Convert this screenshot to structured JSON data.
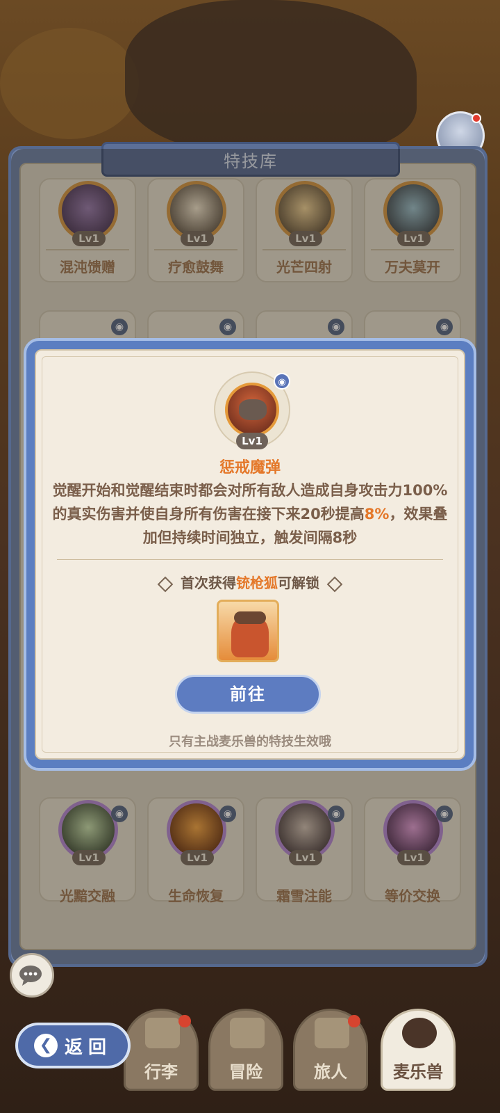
{
  "library": {
    "title": "特技库",
    "row1": [
      {
        "name": "混沌馈赠",
        "level": "Lv1"
      },
      {
        "name": "疗愈鼓舞",
        "level": "Lv1"
      },
      {
        "name": "光芒四射",
        "level": "Lv1"
      },
      {
        "name": "万夫莫开",
        "level": "Lv1"
      }
    ],
    "row3": [
      {
        "name": "光黯交融",
        "level": "Lv1"
      },
      {
        "name": "生命恢复",
        "level": "Lv1"
      },
      {
        "name": "霜雪注能",
        "level": "Lv1"
      },
      {
        "name": "等价交换",
        "level": "Lv1"
      }
    ]
  },
  "modal": {
    "skill_level": "Lv1",
    "skill_name": "惩戒魔弹",
    "desc_part1": "觉醒开始和觉醒结束时都会对所有敌人造成自身攻击力100%的真实伤害并使自身所有伤害在接下来20秒提高",
    "desc_highlight": "8%",
    "desc_part2": "，效果叠加但持续时间独立，触发间隔8秒",
    "unlock_prefix": "首次获得",
    "unlock_pet": "铳枪狐",
    "unlock_suffix": "可解锁",
    "goto_label": "前往",
    "footnote": "只有主战麦乐兽的特技生效哦"
  },
  "nav": {
    "back_label": "返回",
    "items": [
      {
        "label": "行李"
      },
      {
        "label": "冒险"
      },
      {
        "label": "旅人"
      },
      {
        "label": "麦乐兽"
      }
    ]
  },
  "colors": {
    "accent_orange": "#e4782a",
    "modal_blue": "#5b7ec1",
    "parchment": "#f3ece0"
  }
}
